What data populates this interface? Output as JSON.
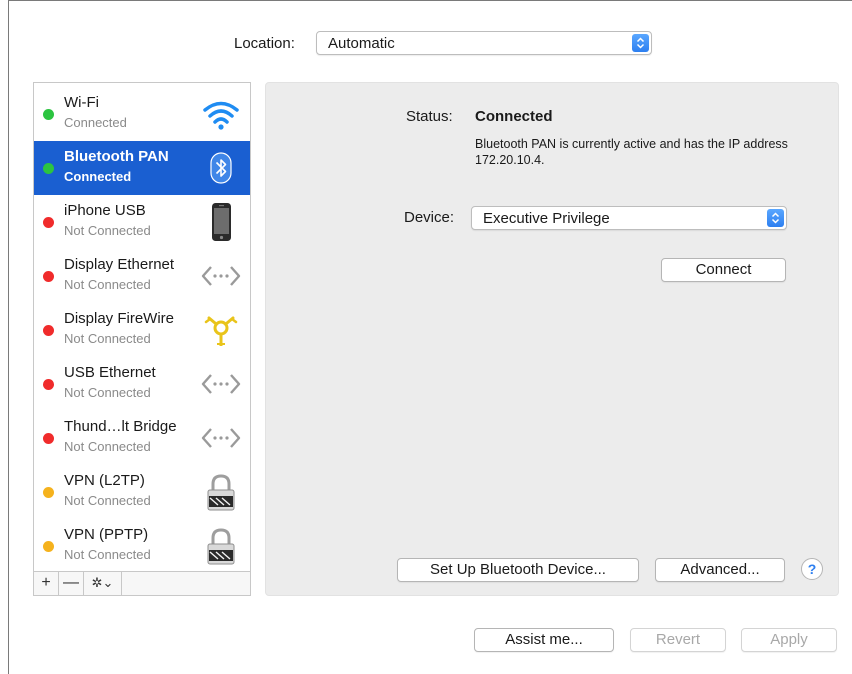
{
  "location": {
    "label": "Location:",
    "value": "Automatic"
  },
  "services": [
    {
      "name": "Wi-Fi",
      "status": "Connected",
      "dot": "#2cc440",
      "icon": "wifi-icon",
      "selected": false
    },
    {
      "name": "Bluetooth PAN",
      "status": "Connected",
      "dot": "#2cc440",
      "icon": "bluetooth-icon",
      "selected": true
    },
    {
      "name": "iPhone USB",
      "status": "Not Connected",
      "dot": "#f02b2b",
      "icon": "iphone-icon",
      "selected": false
    },
    {
      "name": "Display Ethernet",
      "status": "Not Connected",
      "dot": "#f02b2b",
      "icon": "ethernet-icon",
      "selected": false
    },
    {
      "name": "Display FireWire",
      "status": "Not Connected",
      "dot": "#f02b2b",
      "icon": "firewire-icon",
      "selected": false
    },
    {
      "name": "USB Ethernet",
      "status": "Not Connected",
      "dot": "#f02b2b",
      "icon": "ethernet-icon",
      "selected": false
    },
    {
      "name": "Thund…lt Bridge",
      "status": "Not Connected",
      "dot": "#f02b2b",
      "icon": "ethernet-icon",
      "selected": false
    },
    {
      "name": "VPN (L2TP)",
      "status": "Not Connected",
      "dot": "#f5b21d",
      "icon": "lock-icon",
      "selected": false
    },
    {
      "name": "VPN (PPTP)",
      "status": "Not Connected",
      "dot": "#f5b21d",
      "icon": "lock-icon",
      "selected": false
    }
  ],
  "sidebar_bar": {
    "add": "+",
    "remove": "—",
    "gear": "✲⌄"
  },
  "detail": {
    "status_label": "Status:",
    "status_value": "Connected",
    "status_desc": "Bluetooth PAN is currently active and has the IP address 172.20.10.4.",
    "device_label": "Device:",
    "device_value": "Executive Privilege",
    "connect": "Connect",
    "setup": "Set Up Bluetooth Device...",
    "advanced": "Advanced...",
    "help": "?"
  },
  "footer": {
    "assist": "Assist me...",
    "revert": "Revert",
    "apply": "Apply"
  },
  "colors": {
    "accent": "#1a5fd1",
    "popup_arrow": "#2d7ff0"
  }
}
